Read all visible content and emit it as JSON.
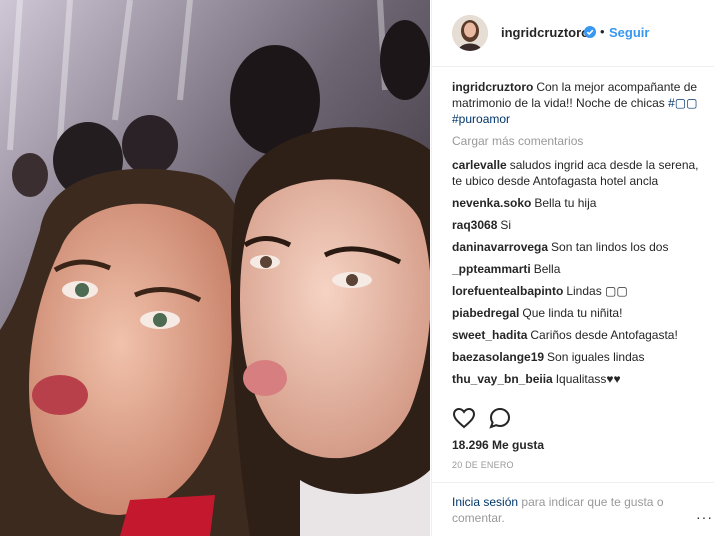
{
  "post": {
    "username": "ingridcruztoro",
    "follow_label": "Seguir",
    "dot": "•",
    "caption_user": "ingridcruztoro",
    "caption_text": "Con la mejor acompañante de matrimonio de la vida!! Noche de chicas",
    "caption_tag1": "#▢▢",
    "caption_tag2": "#puroamor",
    "load_more": "Cargar más comentarios",
    "likes": "18.296 Me gusta",
    "date": "20 DE ENERO",
    "login_link": "Inicia sesión",
    "login_rest": "para indicar que te gusta o comentar.",
    "more_options": "···"
  },
  "comments": [
    {
      "user": "carlevalle",
      "text": "saludos ingrid aca desde la serena, te ubico desde Antofagasta hotel ancla"
    },
    {
      "user": "nevenka.soko",
      "text": "Bella tu hija"
    },
    {
      "user": "raq3068",
      "text": "Si"
    },
    {
      "user": "daninavarrovega",
      "text": "Son tan lindos los dos"
    },
    {
      "user": "_ppteammarti",
      "text": "Bella"
    },
    {
      "user": "lorefuentealbapinto",
      "text": "Lindas ▢▢"
    },
    {
      "user": "piabedregal",
      "text": "Que linda tu niñita!"
    },
    {
      "user": "sweet_hadita",
      "text": "Cariños desde Antofagasta!"
    },
    {
      "user": "baezasolange19",
      "text": "Son iguales lindas"
    },
    {
      "user": "thu_vay_bn_beiia",
      "text": "Iqualitass♥♥"
    }
  ],
  "icons": {
    "heart": "heart-icon",
    "comment": "comment-icon",
    "verified": "verified-badge-icon",
    "more": "more-options-icon"
  },
  "colors": {
    "link_blue": "#3897f0",
    "hashtag": "#003569",
    "muted": "#999999",
    "text": "#262626"
  }
}
